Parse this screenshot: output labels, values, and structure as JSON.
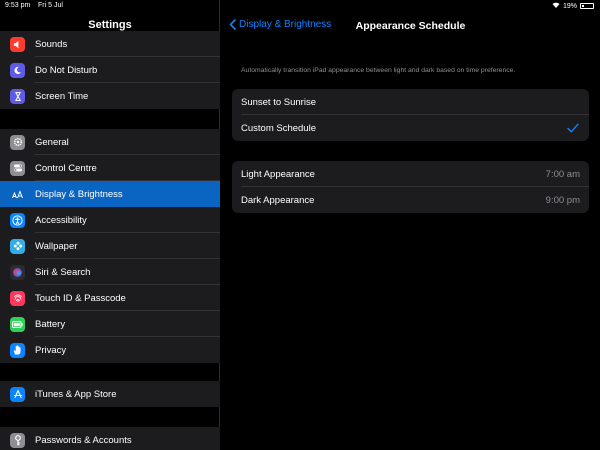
{
  "status": {
    "time": "9:53 pm",
    "date": "Fri 5 Jul",
    "battery": "19%",
    "battery_level": 0.19
  },
  "sidebar": {
    "title": "Settings",
    "group1": [
      {
        "label": "Sounds",
        "icon": "speaker-icon",
        "color": "#ff3b30"
      },
      {
        "label": "Do Not Disturb",
        "icon": "moon-icon",
        "color": "#5e5ce6"
      },
      {
        "label": "Screen Time",
        "icon": "hourglass-icon",
        "color": "#5e5ce6"
      }
    ],
    "group2": [
      {
        "label": "General",
        "icon": "gear-icon",
        "color": "#8e8e93"
      },
      {
        "label": "Control Centre",
        "icon": "switches-icon",
        "color": "#8e8e93"
      },
      {
        "label": "Display & Brightness",
        "icon": "text-size-icon",
        "color": "#0a84ff",
        "selected": true
      },
      {
        "label": "Accessibility",
        "icon": "accessibility-icon",
        "color": "#0a84ff"
      },
      {
        "label": "Wallpaper",
        "icon": "flower-icon",
        "color": "#32ade6"
      },
      {
        "label": "Siri & Search",
        "icon": "siri-icon",
        "color": "#2c2c2e"
      },
      {
        "label": "Touch ID & Passcode",
        "icon": "fingerprint-icon",
        "color": "#ff375f"
      },
      {
        "label": "Battery",
        "icon": "battery-icon",
        "color": "#30d158"
      },
      {
        "label": "Privacy",
        "icon": "hand-icon",
        "color": "#0a84ff"
      }
    ],
    "group3": [
      {
        "label": "iTunes & App Store",
        "icon": "app-store-icon",
        "color": "#0a84ff"
      }
    ],
    "group4": [
      {
        "label": "Passwords & Accounts",
        "icon": "key-icon",
        "color": "#8e8e93"
      }
    ]
  },
  "detail": {
    "back_label": "Display & Brightness",
    "title": "Appearance Schedule",
    "description": "Automatically transition iPad appearance between light and dark based on time preference.",
    "options": [
      {
        "label": "Sunset to Sunrise",
        "checked": false
      },
      {
        "label": "Custom Schedule",
        "checked": true
      }
    ],
    "times": [
      {
        "label": "Light Appearance",
        "value": "7:00 am"
      },
      {
        "label": "Dark Appearance",
        "value": "9:00 pm"
      }
    ]
  }
}
